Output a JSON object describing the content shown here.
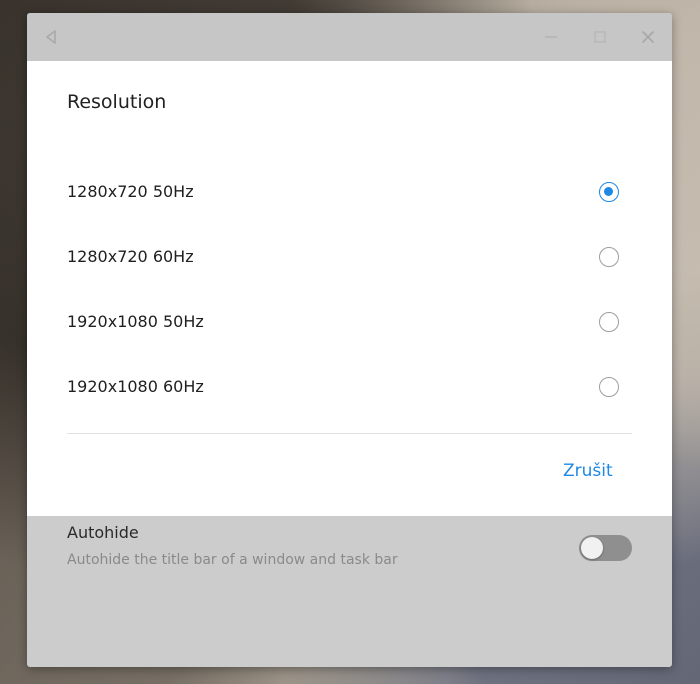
{
  "titlebar": {
    "back_icon": "back-triangle-icon",
    "minimize_icon": "minimize-icon",
    "maximize_icon": "maximize-icon",
    "close_icon": "close-icon"
  },
  "dialog": {
    "title": "Resolution",
    "options": [
      {
        "label": "1280x720 50Hz",
        "selected": true
      },
      {
        "label": "1280x720 60Hz",
        "selected": false
      },
      {
        "label": "1920x1080 50Hz",
        "selected": false
      },
      {
        "label": "1920x1080 60Hz",
        "selected": false
      }
    ],
    "cancel_label": "Zrušit"
  },
  "settings": {
    "autohide_title": "Autohide",
    "autohide_description": "Autohide the title bar of a window and task bar",
    "autohide_enabled": false
  },
  "colors": {
    "accent": "#1e88e5",
    "titlebar": "#c6c6c6",
    "window_bg": "#cccccc",
    "dialog_bg": "#ffffff"
  }
}
